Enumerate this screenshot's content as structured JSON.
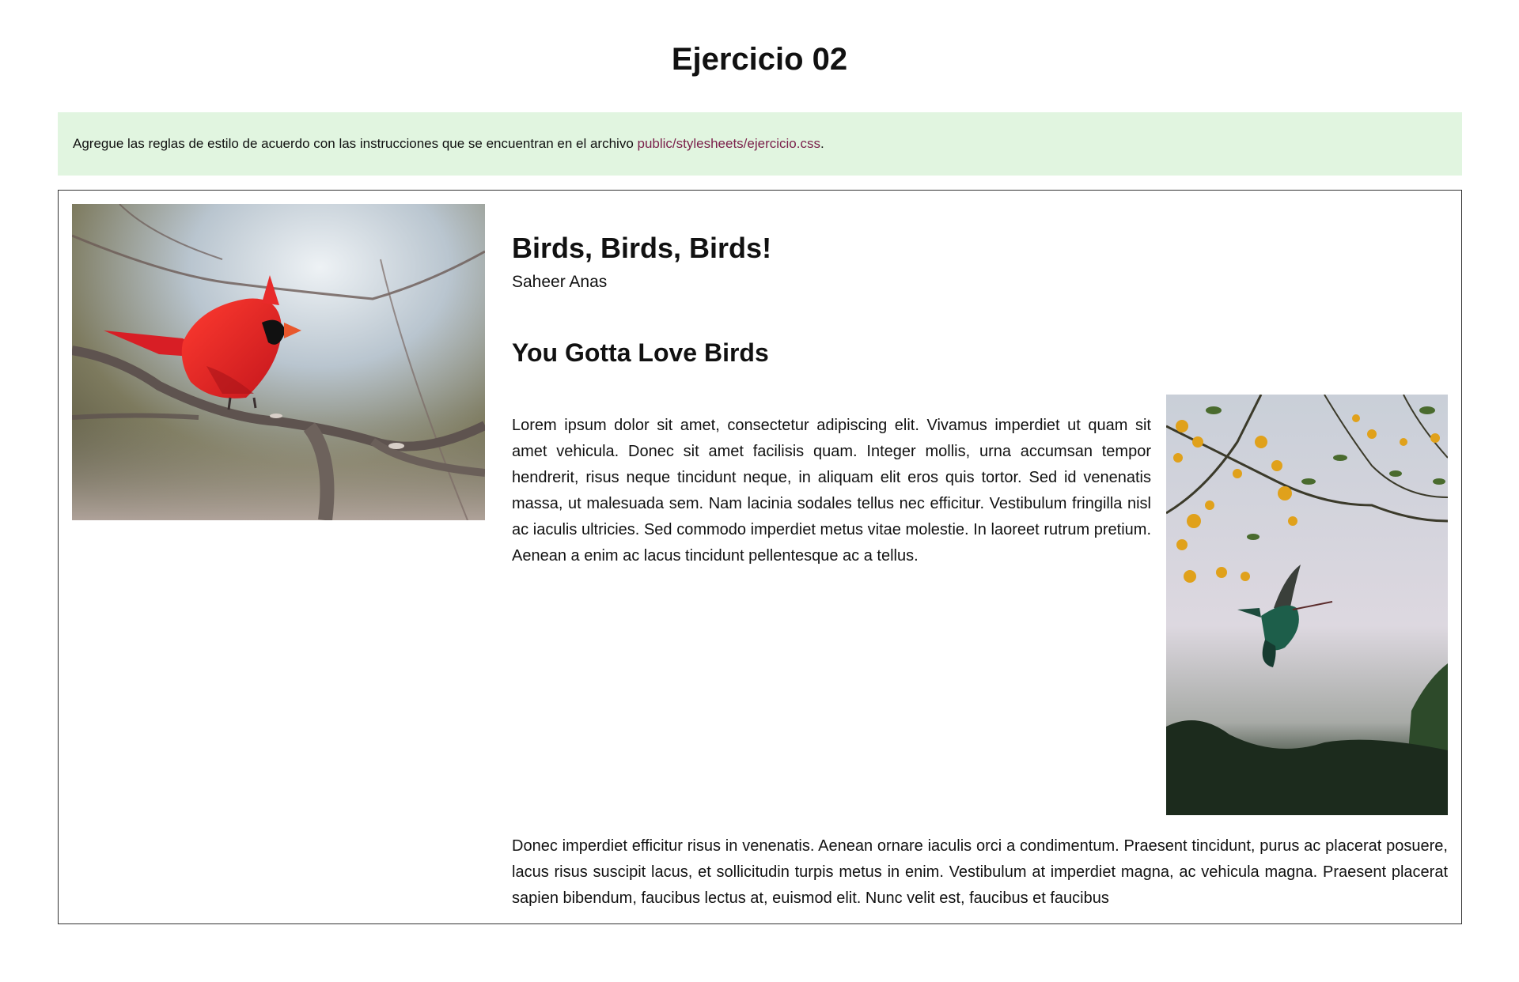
{
  "page": {
    "title": "Ejercicio 02"
  },
  "instructions": {
    "text": "Agregue las reglas de estilo de acuerdo con las instrucciones que se encuentran en el archivo ",
    "link_text": "public/stylesheets/ejercicio.css",
    "suffix": ".",
    "link_color": "#7a1f4a",
    "background": "#e1f5e0"
  },
  "article": {
    "heading": "Birds, Birds, Birds!",
    "author": "Saheer Anas",
    "section_heading": "You Gotta Love Birds",
    "paragraphs": [
      "Lorem ipsum dolor sit amet, consectetur adipiscing elit. Vivamus imperdiet ut quam sit amet vehicula. Donec sit amet facilisis quam. Integer mollis, urna accumsan tempor hendrerit, risus neque tincidunt neque, in aliquam elit eros quis tortor. Sed id venenatis massa, ut malesuada sem. Nam lacinia sodales tellus nec efficitur. Vestibulum fringilla nisl ac iaculis ultricies. Sed commodo imperdiet metus vitae molestie. In laoreet rutrum pretium. Aenean a enim ac lacus tincidunt pellentesque ac a tellus.",
      "Donec imperdiet efficitur risus in venenatis. Aenean ornare iaculis orci a condimentum. Praesent tincidunt, purus ac placerat posuere, lacus risus suscipit lacus, et sollicitudin turpis metus in enim. Vestibulum at imperdiet magna, ac vehicula magna. Praesent placerat sapien bibendum, faucibus lectus at, euismod elit. Nunc velit est, faucibus et faucibus"
    ],
    "images": {
      "cardinal": "cardinal-photo",
      "hummingbird": "hummingbird-photo"
    }
  }
}
